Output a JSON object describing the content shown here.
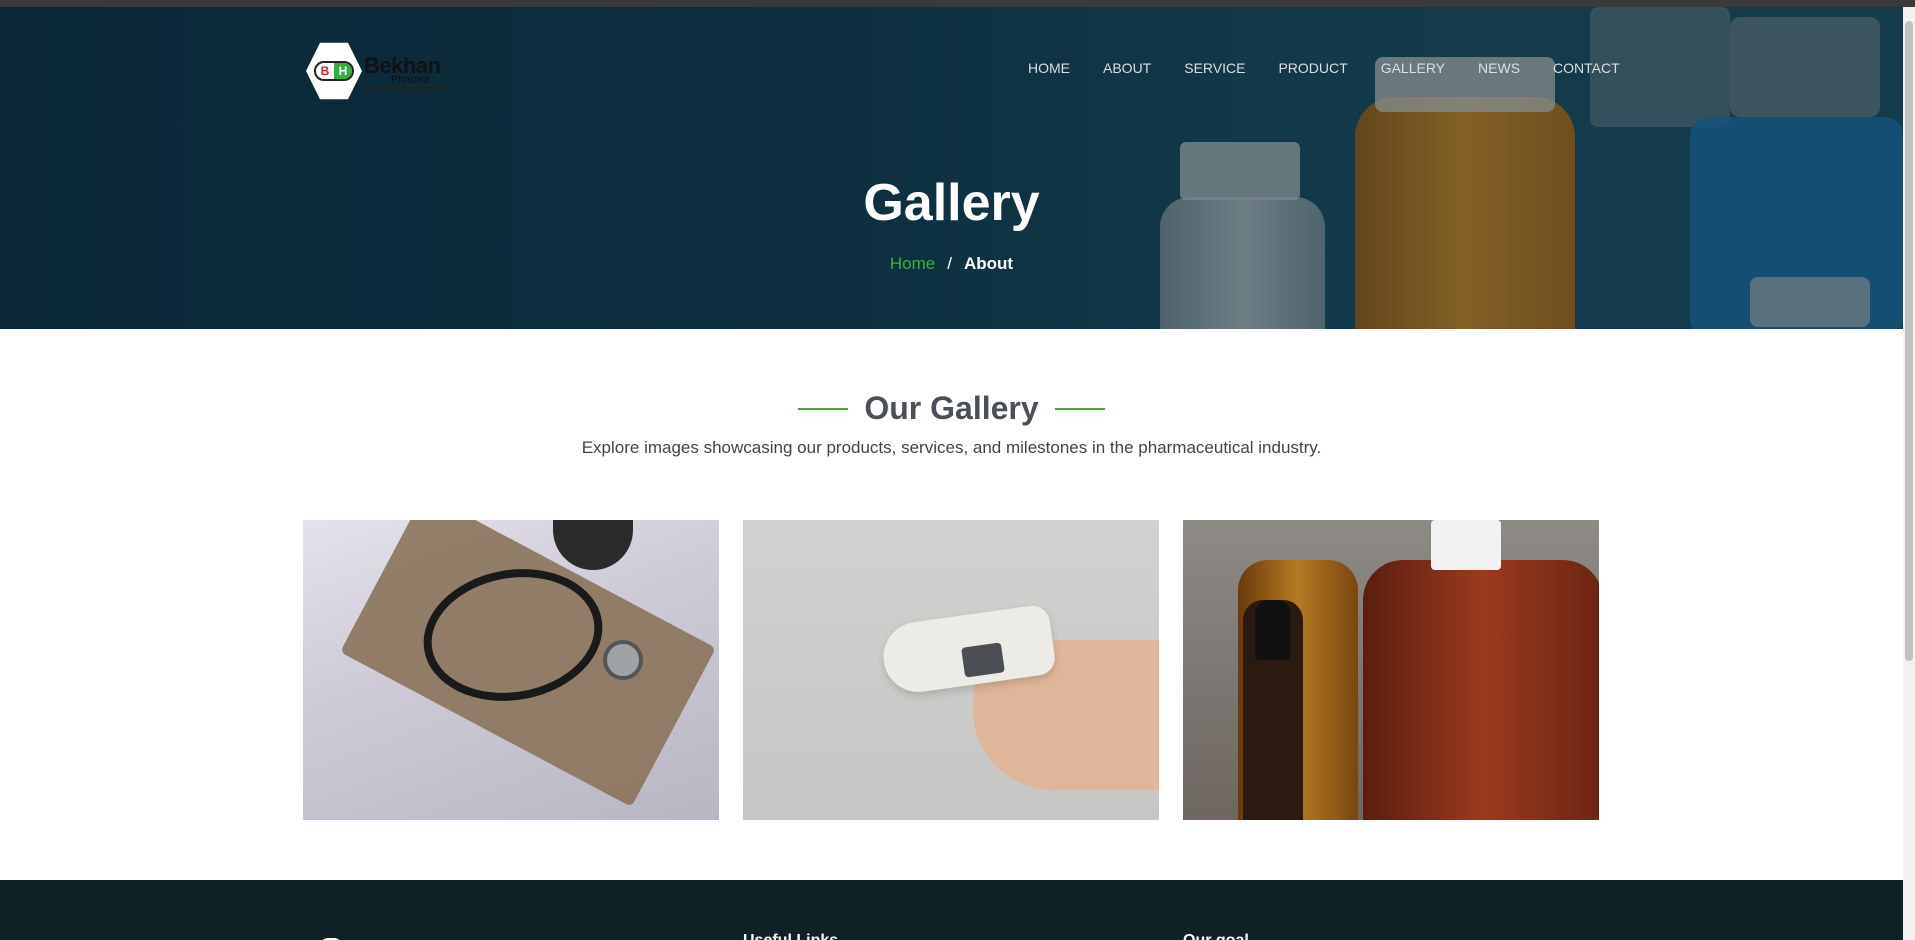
{
  "brand": {
    "name": "Bekhan",
    "sub": "Pharma",
    "logo_letters": [
      "B",
      "H"
    ]
  },
  "nav": {
    "items": [
      "HOME",
      "ABOUT",
      "SERVICE",
      "PRODUCT",
      "GALLERY",
      "NEWS",
      "CONTACT"
    ]
  },
  "hero": {
    "title": "Gallery",
    "breadcrumb": {
      "home": "Home",
      "separator": "/",
      "current": "About"
    }
  },
  "gallery": {
    "title": "Our Gallery",
    "description": "Explore images showcasing our products, services, and milestones in the pharmaceutical industry.",
    "images": [
      "stethoscope-and-blood-pressure-cuff",
      "hand-holding-ear-thermometer",
      "amber-medicine-bottles"
    ]
  },
  "footer": {
    "useful_links": "Useful Links",
    "our_goal": "Our goal"
  },
  "colors": {
    "accent": "#3fae3a",
    "hero_bg": "#123a4c",
    "footer_bg": "#0f2228"
  }
}
